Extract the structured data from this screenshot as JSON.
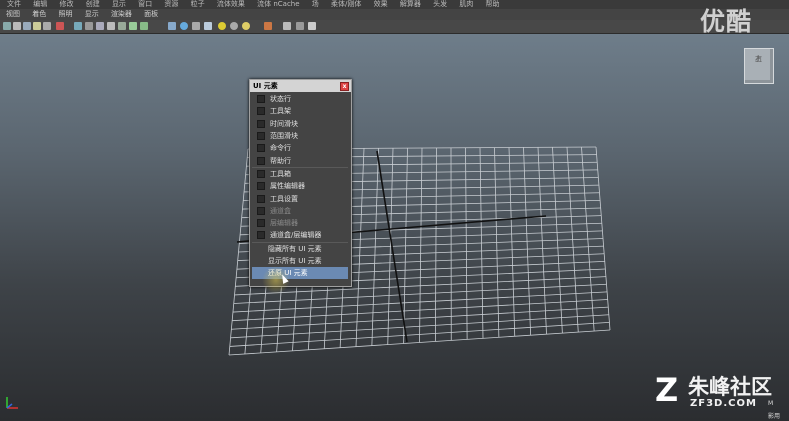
{
  "menubar": [
    "文件",
    "编辑",
    "修改",
    "创建",
    "显示",
    "窗口",
    "资源",
    "粒子",
    "流体效果",
    "流体 nCache",
    "场",
    "柔体/刚体",
    "效果",
    "解算器",
    "头发",
    "肌肉",
    "帮助"
  ],
  "panel_menu": [
    "视图",
    "着色",
    "照明",
    "显示",
    "渲染器",
    "面板"
  ],
  "watermark": "优酷",
  "viewcube": {
    "top": "上",
    "side": "右"
  },
  "ui_window": {
    "title": "UI 元素",
    "close_glyph": "x",
    "items": [
      {
        "label": "状态行",
        "checkbox": true
      },
      {
        "label": "工具架",
        "checkbox": true
      },
      {
        "label": "时间滑块",
        "checkbox": true
      },
      {
        "label": "范围滑块",
        "checkbox": true
      },
      {
        "label": "命令行",
        "checkbox": true
      },
      {
        "label": "帮助行",
        "checkbox": true
      },
      {
        "label": "工具箱",
        "checkbox": true
      },
      {
        "label": "属性编辑器",
        "checkbox": true
      },
      {
        "label": "工具设置",
        "checkbox": true
      },
      {
        "label": "通道盒",
        "checkbox": true
      },
      {
        "label": "层编辑器",
        "checkbox": true
      },
      {
        "label": "通道盒/层编辑器",
        "checkbox": true
      },
      {
        "label": "隐藏所有 UI 元素",
        "checkbox": false
      },
      {
        "label": "显示所有 UI 元素",
        "checkbox": false
      },
      {
        "label": "还原 UI 元素",
        "checkbox": false
      }
    ]
  },
  "logo": {
    "main": "朱峰社区",
    "sub": "ZF3D.COM"
  },
  "status": {
    "line1": "M",
    "line2": "影用"
  },
  "colors": {
    "highlight": "#6b8ab3",
    "grid": "#c8cdd2",
    "axis": "#111111"
  }
}
